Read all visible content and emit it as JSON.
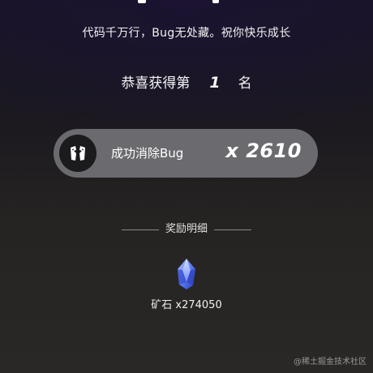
{
  "header": {
    "slogan": "代码千万行，Bug无处藏。祝你快乐成长"
  },
  "rank": {
    "prefix": "恭喜获得第",
    "number": "1",
    "suffix": "名"
  },
  "achievement": {
    "icon": "bug-crush-icon",
    "label": "成功消除Bug",
    "count": "x 2610"
  },
  "reward": {
    "title": "奖励明细",
    "items": [
      {
        "icon": "ore-crystal-icon",
        "label": "矿石 x274050"
      }
    ]
  },
  "watermark": "@稀土掘金技术社区",
  "colors": {
    "pill_background": "#6b6a6f",
    "icon_background": "#1b1a1c",
    "crystal_blue": "#5a7cf2"
  }
}
